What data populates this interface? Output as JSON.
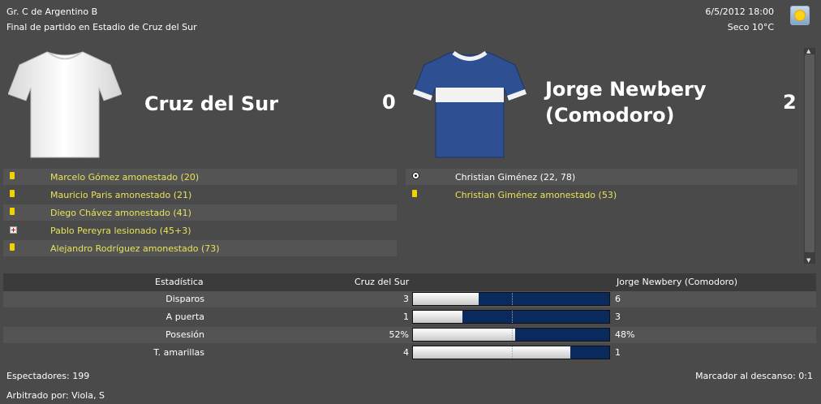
{
  "header": {
    "competition": "Gr. C de Argentino B",
    "subtitle": "Final de partido en Estadio de Cruz del Sur",
    "datetime": "6/5/2012 18:00",
    "weather": "Seco 10°C",
    "weather_icon": "sunny-icon"
  },
  "home": {
    "name": "Cruz del Sur",
    "score": "0",
    "shirt_color": "#f2f2f2",
    "events": [
      {
        "icon": "yellow-card",
        "text": "Marcelo Gómez amonestado (20)"
      },
      {
        "icon": "yellow-card",
        "text": "Mauricio Paris amonestado (21)"
      },
      {
        "icon": "yellow-card",
        "text": "Diego Chávez amonestado (41)"
      },
      {
        "icon": "injury",
        "text": "Pablo Pereyra lesionado (45+3)"
      },
      {
        "icon": "yellow-card",
        "text": "Alejandro Rodríguez amonestado (73)"
      }
    ]
  },
  "away": {
    "name_line1": "Jorge Newbery",
    "name_line2": "(Comodoro)",
    "score": "2",
    "shirt_color": "#2f4f93",
    "events": [
      {
        "icon": "goal-ball",
        "text": "Christian Giménez (22, 78)"
      },
      {
        "icon": "yellow-card",
        "text": "Christian Giménez amonestado (53)"
      }
    ]
  },
  "stats": {
    "header_label": "Estadística",
    "home_label": "Cruz del Sur",
    "away_label": "Jorge Newbery (Comodoro)",
    "rows": [
      {
        "label": "Disparos",
        "home": "3",
        "away": "6",
        "home_share": 0.333
      },
      {
        "label": "A puerta",
        "home": "1",
        "away": "3",
        "home_share": 0.25
      },
      {
        "label": "Posesión",
        "home": "52%",
        "away": "48%",
        "home_share": 0.52
      },
      {
        "label": "T. amarillas",
        "home": "4",
        "away": "1",
        "home_share": 0.8
      }
    ]
  },
  "footer": {
    "spectators": "Espectadores: 199",
    "referee": "Arbitrado por: Viola, S",
    "halftime": "Marcador al descanso: 0:1"
  },
  "colors": {
    "background": "#4a4a4a",
    "event_text": "#e8e35c",
    "bar_away": "#0a2a5e",
    "yellow_card": "#f1d100"
  }
}
